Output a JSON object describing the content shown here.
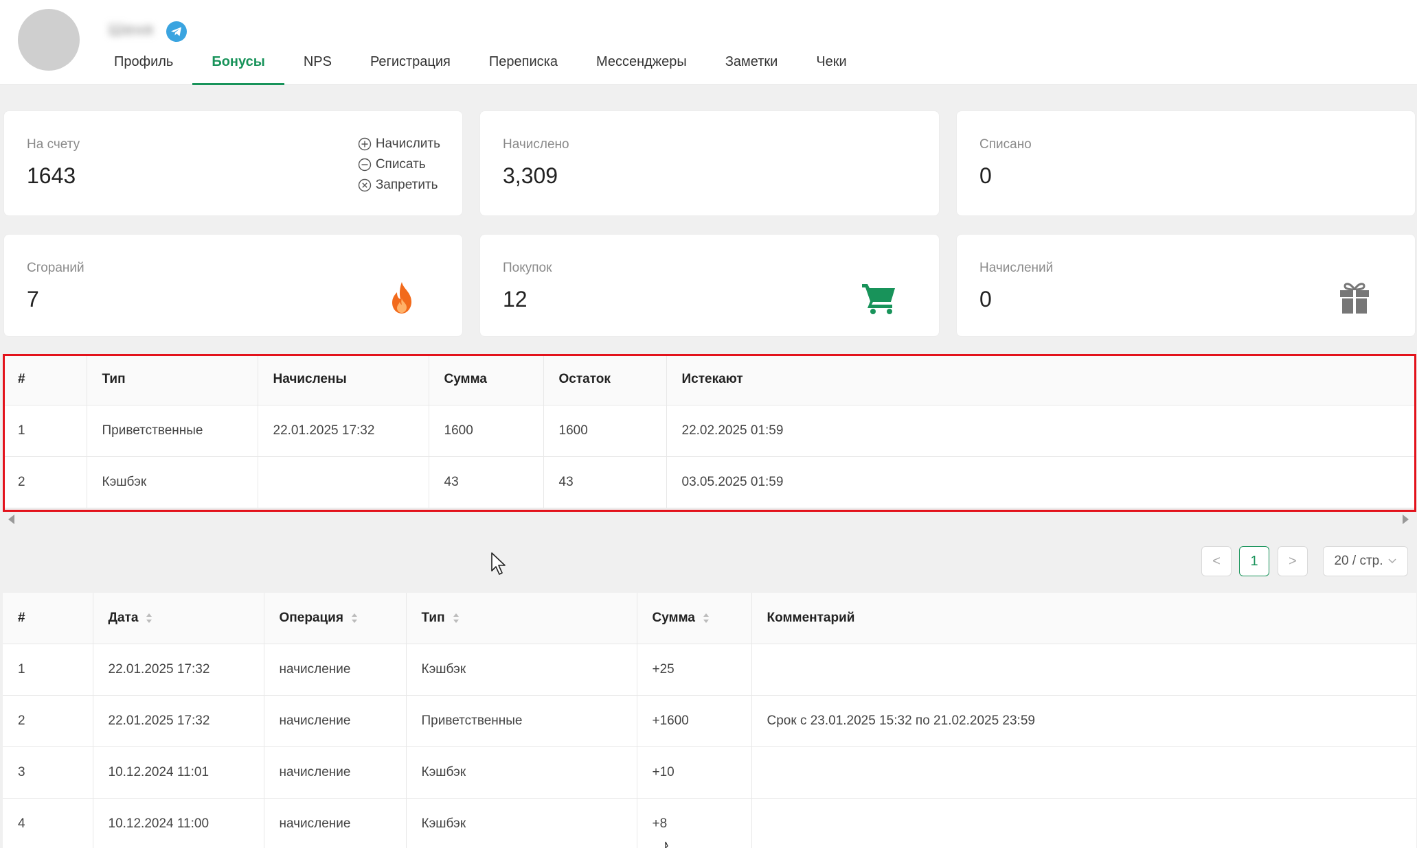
{
  "header": {
    "user_name": "Шеня",
    "tabs": [
      {
        "label": "Профиль",
        "active": false
      },
      {
        "label": "Бонусы",
        "active": true
      },
      {
        "label": "NPS",
        "active": false
      },
      {
        "label": "Регистрация",
        "active": false
      },
      {
        "label": "Переписка",
        "active": false
      },
      {
        "label": "Мессенджеры",
        "active": false
      },
      {
        "label": "Заметки",
        "active": false
      },
      {
        "label": "Чеки",
        "active": false
      }
    ]
  },
  "stats": {
    "balance": {
      "label": "На счету",
      "value": "1643"
    },
    "actions": {
      "accrue": "Начислить",
      "write_off": "Списать",
      "forbid": "Запретить"
    },
    "accrued": {
      "label": "Начислено",
      "value": "3,309"
    },
    "written_off": {
      "label": "Списано",
      "value": "0"
    },
    "burned": {
      "label": "Сгораний",
      "value": "7"
    },
    "purchases": {
      "label": "Покупок",
      "value": "12"
    },
    "accruals": {
      "label": "Начислений",
      "value": "0"
    }
  },
  "balances_table": {
    "columns": [
      "#",
      "Тип",
      "Начислены",
      "Сумма",
      "Остаток",
      "Истекают"
    ],
    "rows": [
      [
        "1",
        "Приветственные",
        "22.01.2025 17:32",
        "1600",
        "1600",
        "22.02.2025 01:59"
      ],
      [
        "2",
        "Кэшбэк",
        "",
        "43",
        "43",
        "03.05.2025 01:59"
      ]
    ]
  },
  "pagination": {
    "prev": "<",
    "current": "1",
    "next": ">",
    "page_size": "20 / стр."
  },
  "history_table": {
    "columns": [
      "#",
      "Дата",
      "Операция",
      "Тип",
      "Сумма",
      "Комментарий"
    ],
    "rows": [
      [
        "1",
        "22.01.2025 17:32",
        "начисление",
        "Кэшбэк",
        "+25",
        ""
      ],
      [
        "2",
        "22.01.2025 17:32",
        "начисление",
        "Приветственные",
        "+1600",
        "Срок с 23.01.2025 15:32 по 21.02.2025 23:59"
      ],
      [
        "3",
        "10.12.2024 11:01",
        "начисление",
        "Кэшбэк",
        "+10",
        ""
      ],
      [
        "4",
        "10.12.2024 11:00",
        "начисление",
        "Кэшбэк",
        "+8",
        ""
      ]
    ]
  },
  "colors": {
    "accent": "#18935a",
    "fire": "#f26a1b",
    "cart": "#18935a",
    "gift": "#777777",
    "highlight": "#e3121b"
  }
}
